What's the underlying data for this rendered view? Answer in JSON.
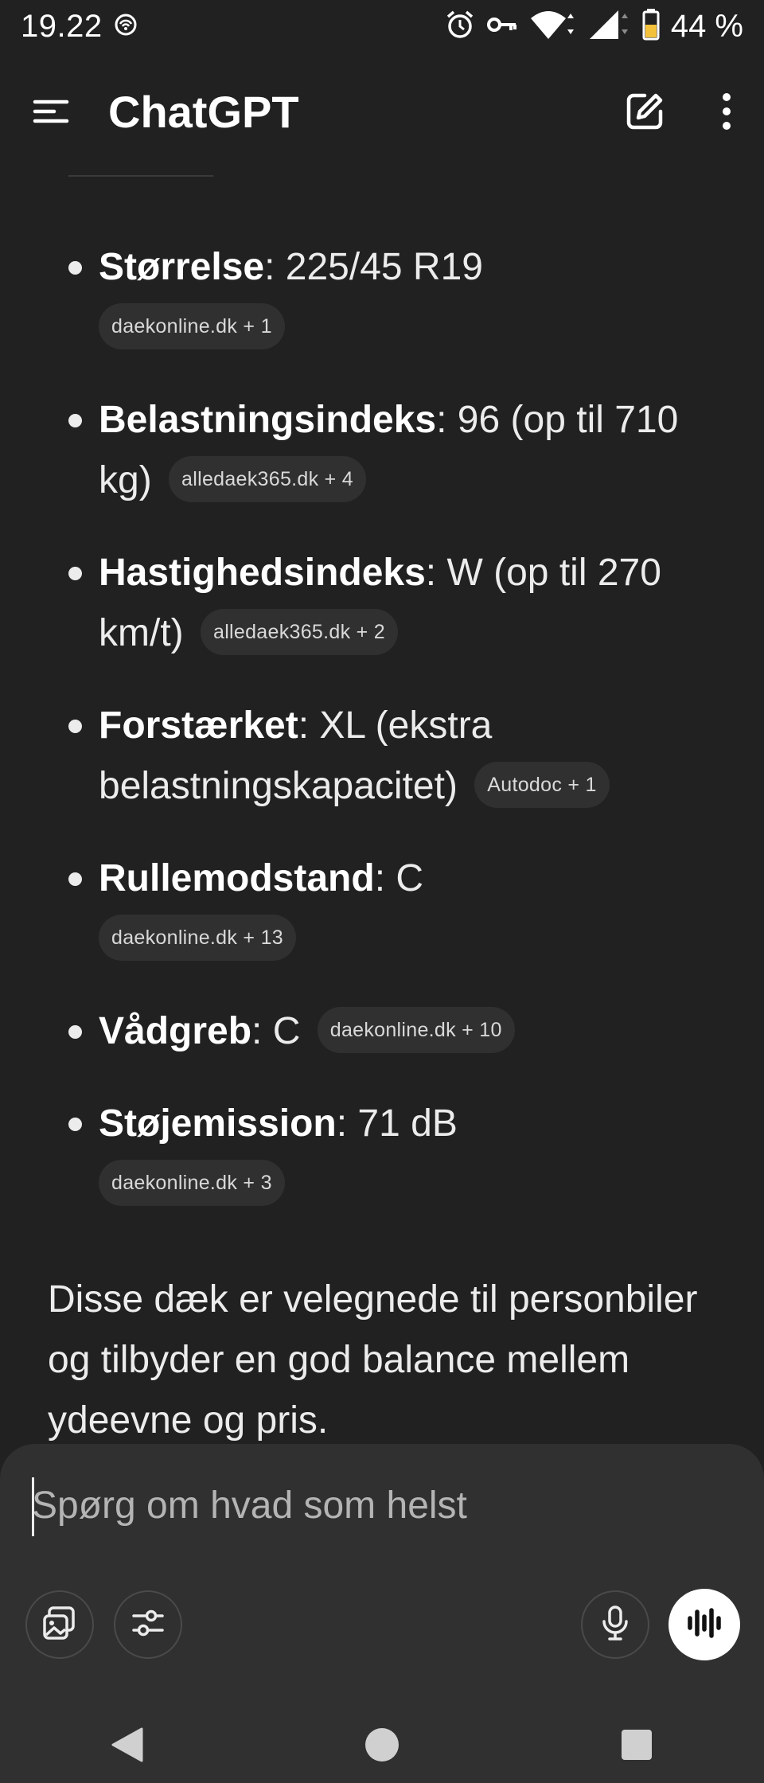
{
  "status_bar": {
    "time": "19.22",
    "battery": "44 %",
    "icons": [
      "hotspot-icon",
      "alarm-icon",
      "vpn-key-icon",
      "wifi-icon",
      "cell-signal-icon",
      "battery-icon"
    ]
  },
  "app_bar": {
    "title": "ChatGPT",
    "icons": [
      "menu-icon",
      "new-chat-icon",
      "more-vert-icon"
    ]
  },
  "specs": [
    {
      "term": "Størrelse",
      "value": ": 225/45 R19",
      "source": "daekonline.dk + 1"
    },
    {
      "term": "Belastningsindeks",
      "value": ": 96 (op til 710 kg)",
      "source": "alledaek365.dk + 4"
    },
    {
      "term": "Hastighedsindeks",
      "value": ": W (op til 270 km/t)",
      "source": "alledaek365.dk + 2"
    },
    {
      "term": "Forstærket",
      "value": ": XL (ekstra belastningskapacitet)",
      "source": "Autodoc + 1"
    },
    {
      "term": "Rullemodstand",
      "value": ": C",
      "source": "daekonline.dk + 13"
    },
    {
      "term": "Vådgreb",
      "value": ": C",
      "source": "daekonline.dk + 10"
    },
    {
      "term": "Støjemission",
      "value": ": 71 dB",
      "source": "daekonline.dk + 3"
    }
  ],
  "summary": "Disse dæk er velegnede til personbiler og tilbyder en god balance mellem ydeevne og pris.",
  "composer": {
    "placeholder": "Spørg om hvad som helst",
    "icons": [
      "image-icon",
      "tools-sliders-icon",
      "microphone-icon",
      "voice-waveform-icon"
    ]
  },
  "nav_bar": {
    "icons": [
      "back-icon",
      "home-icon",
      "recents-icon"
    ]
  }
}
